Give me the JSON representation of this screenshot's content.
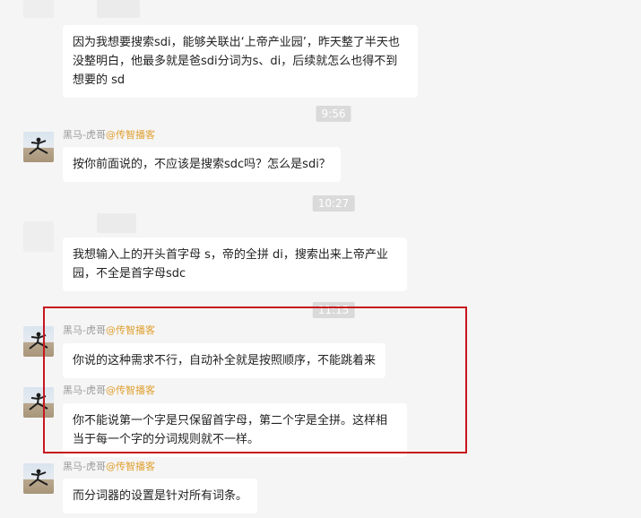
{
  "messages": [
    {
      "text": "因为我想要搜索sdi，能够关联出‘上帝产业园’，昨天整了半天也没整明白，他最多就是爸sdi分词为s、di，后续就怎么也得不到想要的 sd"
    },
    {
      "sender": "黑马-虎哥",
      "org": "@传智播客",
      "text": "按你前面说的，不应该是搜索sdc吗？怎么是sdi？"
    },
    {
      "text": "我想输入上的开头首字母 s，帝的全拼 di，搜索出来上帝产业园，不全是首字母sdc"
    },
    {
      "sender": "黑马-虎哥",
      "org": "@传智播客",
      "text": "你说的这种需求不行，自动补全就是按照顺序，不能跳着来"
    },
    {
      "sender": "黑马-虎哥",
      "org": "@传智播客",
      "text": "你不能说第一个字是只保留首字母，第二个字是全拼。这样相当于每一个字的分词规则就不一样。"
    },
    {
      "sender": "黑马-虎哥",
      "org": "@传智播客",
      "text": "而分词器的设置是针对所有词条。"
    }
  ],
  "timestamps": [
    "9:56",
    "10:27",
    "11:15"
  ],
  "avatar_icon": "person-avatar-icon",
  "highlight_color": "#c8171f"
}
